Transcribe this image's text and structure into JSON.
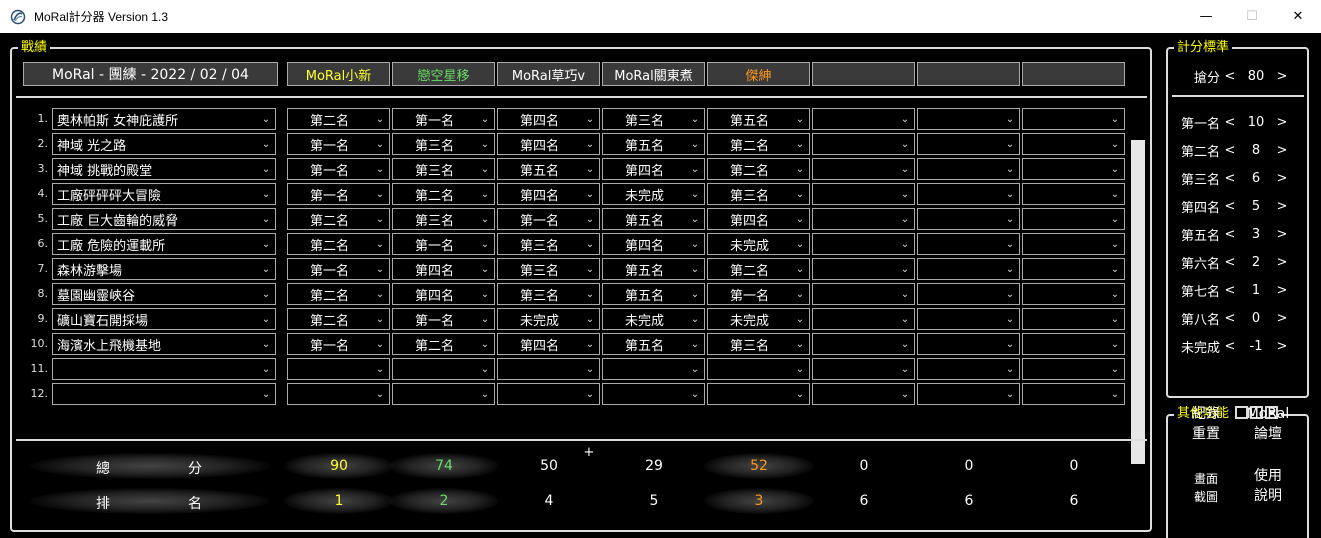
{
  "window": {
    "title": "MoRal計分器 Version 1.3",
    "min": "—",
    "max": "☐",
    "close": "✕"
  },
  "record": {
    "title": "戰績",
    "event_title": "MoRal - 團練 - 2022 / 02 / 04",
    "players": [
      {
        "name": "MoRal小新",
        "color": "#ffff33"
      },
      {
        "name": "戀空星移",
        "color": "#66dd66"
      },
      {
        "name": "MoRal草巧v",
        "color": "#ffffff"
      },
      {
        "name": "MoRal關東煮",
        "color": "#ffffff"
      },
      {
        "name": "傑紳",
        "color": "#ff9922"
      },
      {
        "name": "",
        "color": "#ffffff"
      },
      {
        "name": "",
        "color": "#ffffff"
      },
      {
        "name": "",
        "color": "#ffffff"
      }
    ],
    "rows": [
      {
        "num": "1.",
        "map": "奧林帕斯 女神庇護所",
        "ranks": [
          "第二名",
          "第一名",
          "第四名",
          "第三名",
          "第五名",
          "",
          "",
          ""
        ]
      },
      {
        "num": "2.",
        "map": "神域 光之路",
        "ranks": [
          "第一名",
          "第三名",
          "第四名",
          "第五名",
          "第二名",
          "",
          "",
          ""
        ]
      },
      {
        "num": "3.",
        "map": "神域 挑戰的殿堂",
        "ranks": [
          "第一名",
          "第三名",
          "第五名",
          "第四名",
          "第二名",
          "",
          "",
          ""
        ]
      },
      {
        "num": "4.",
        "map": "工廠砰砰砰大冒險",
        "ranks": [
          "第一名",
          "第二名",
          "第四名",
          "未完成",
          "第三名",
          "",
          "",
          ""
        ]
      },
      {
        "num": "5.",
        "map": "工廠 巨大齒輪的威脅",
        "ranks": [
          "第二名",
          "第三名",
          "第一名",
          "第五名",
          "第四名",
          "",
          "",
          ""
        ]
      },
      {
        "num": "6.",
        "map": "工廠 危險的運載所",
        "ranks": [
          "第二名",
          "第一名",
          "第三名",
          "第四名",
          "未完成",
          "",
          "",
          ""
        ]
      },
      {
        "num": "7.",
        "map": "森林游擊場",
        "ranks": [
          "第一名",
          "第四名",
          "第三名",
          "第五名",
          "第二名",
          "",
          "",
          ""
        ]
      },
      {
        "num": "8.",
        "map": "墓園幽靈峽谷",
        "ranks": [
          "第二名",
          "第四名",
          "第三名",
          "第五名",
          "第一名",
          "",
          "",
          ""
        ]
      },
      {
        "num": "9.",
        "map": "礦山寶石開採場",
        "ranks": [
          "第二名",
          "第一名",
          "未完成",
          "未完成",
          "未完成",
          "",
          "",
          ""
        ]
      },
      {
        "num": "10.",
        "map": "海濱水上飛機基地",
        "ranks": [
          "第一名",
          "第二名",
          "第四名",
          "第五名",
          "第三名",
          "",
          "",
          ""
        ]
      },
      {
        "num": "11.",
        "map": "",
        "ranks": [
          "",
          "",
          "",
          "",
          "",
          "",
          "",
          ""
        ]
      },
      {
        "num": "12.",
        "map": "",
        "ranks": [
          "",
          "",
          "",
          "",
          "",
          "",
          "",
          ""
        ]
      }
    ],
    "add_label": "+",
    "total_label_a": "總",
    "total_label_b": "分",
    "rank_label_a": "排",
    "rank_label_b": "名",
    "totals": [
      "90",
      "74",
      "50",
      "29",
      "52",
      "0",
      "0",
      "0"
    ],
    "places": [
      "1",
      "2",
      "4",
      "5",
      "3",
      "6",
      "6",
      "6"
    ]
  },
  "score": {
    "title": "計分標準",
    "grab": {
      "label": "搶分",
      "value": "80"
    },
    "items": [
      {
        "label": "第一名",
        "value": "10"
      },
      {
        "label": "第二名",
        "value": "8"
      },
      {
        "label": "第三名",
        "value": "6"
      },
      {
        "label": "第四名",
        "value": "5"
      },
      {
        "label": "第五名",
        "value": "3"
      },
      {
        "label": "第六名",
        "value": "2"
      },
      {
        "label": "第七名",
        "value": "1"
      },
      {
        "label": "第八名",
        "value": "0"
      },
      {
        "label": "未完成",
        "value": "-1"
      }
    ],
    "dec": "<",
    "inc": ">"
  },
  "other": {
    "title": "其他功能",
    "btn_reset_a": "紀錄",
    "btn_reset_b": "重置",
    "btn_forum_a": "MoRal",
    "btn_forum_b": "論壇",
    "btn_shot_a": "畫面",
    "btn_shot_b": "截圖",
    "btn_help_a": "使用",
    "btn_help_b": "說明"
  }
}
